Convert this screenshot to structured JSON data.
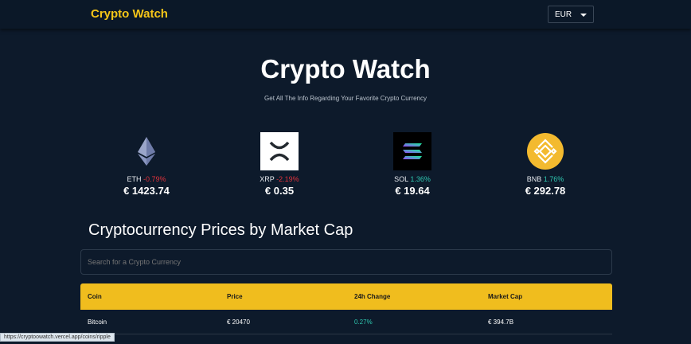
{
  "header": {
    "brand": "Crypto Watch",
    "currency": "EUR"
  },
  "hero": {
    "title": "Crypto Watch",
    "subtitle": "Get All The Info Regarding Your Favorite Crypto Currency"
  },
  "coins": [
    {
      "symbol": "ETH",
      "change": "-0.79%",
      "price": "€ 1423.74"
    },
    {
      "symbol": "XRP",
      "change": "-2.19%",
      "price": "€ 0.35"
    },
    {
      "symbol": "SOL",
      "change": "1.36%",
      "price": "€ 19.64"
    },
    {
      "symbol": "BNB",
      "change": "1.76%",
      "price": "€ 292.78"
    }
  ],
  "section": {
    "title": "Cryptocurrency Prices by Market Cap"
  },
  "search": {
    "placeholder": "Search for a Crypto Currency"
  },
  "table": {
    "headers": [
      "Coin",
      "Price",
      "24h Change",
      "Market Cap"
    ],
    "rows": [
      {
        "coin": "Bitcoin",
        "price": "€ 20470",
        "change": "0.27%",
        "market_cap": "€ 394.7B"
      }
    ]
  },
  "status_url": "https://cryptoowatch.vercel.app/coins/ripple",
  "colors": {
    "accent": "#f0bd1e",
    "background": "#0d1a2b",
    "negative": "#e0323b",
    "positive": "#2ec7b0"
  }
}
